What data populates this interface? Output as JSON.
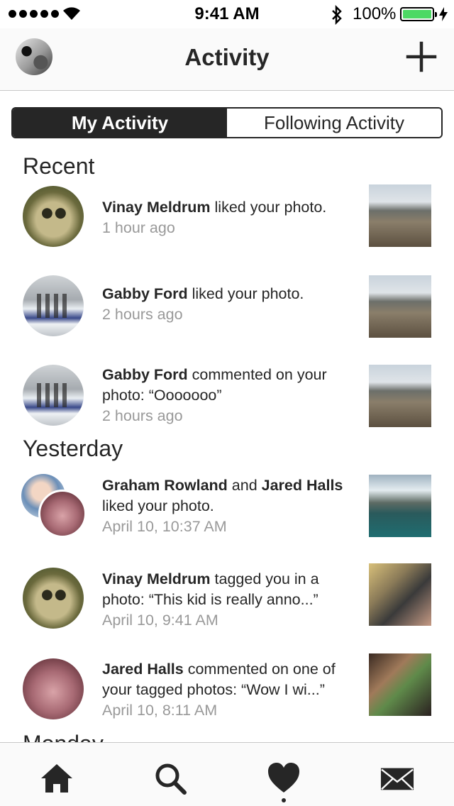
{
  "status_bar": {
    "time": "9:41 AM",
    "battery": "100%",
    "icons": [
      "signal-dots",
      "wifi-icon",
      "bluetooth-icon",
      "battery-icon",
      "charging-bolt-icon"
    ],
    "battery_color": "#4cd964"
  },
  "nav": {
    "title": "Activity",
    "add_icon": "plus-icon"
  },
  "tabs": [
    {
      "label": "My Activity",
      "selected": true
    },
    {
      "label": "Following Activity",
      "selected": false
    }
  ],
  "sections": [
    {
      "title": "Recent",
      "items": [
        {
          "actor": "Vinay Meldrum",
          "text": " liked your photo.",
          "time": "1 hour ago"
        },
        {
          "actor": "Gabby Ford",
          "text": " liked your photo.",
          "time": "2 hours ago"
        },
        {
          "actor": "Gabby Ford",
          "text": " commented on your photo: “Ooooooo”",
          "time": "2 hours ago"
        }
      ]
    },
    {
      "title": "Yesterday",
      "items": [
        {
          "actor": "Graham Rowland",
          "joiner": " and ",
          "actor2": "Jared Halls",
          "text": " liked your photo.",
          "time": "April 10, 10:37 AM"
        },
        {
          "actor": "Vinay Meldrum",
          "text": " tagged you in a photo: “This kid is really anno...”",
          "time": "April 10, 9:41 AM"
        },
        {
          "actor": "Jared Halls",
          "text": " commented on one of your tagged photos: “Wow I wi...”",
          "time": "April 10, 8:11 AM"
        }
      ]
    },
    {
      "title": "Monday"
    }
  ],
  "tab_bar": {
    "icons": [
      "home-icon",
      "search-icon",
      "heart-icon",
      "mail-icon"
    ],
    "active": "heart-icon"
  },
  "colors": {
    "text": "#262626",
    "secondary_text": "#999999",
    "divider": "#c8c8c8"
  }
}
